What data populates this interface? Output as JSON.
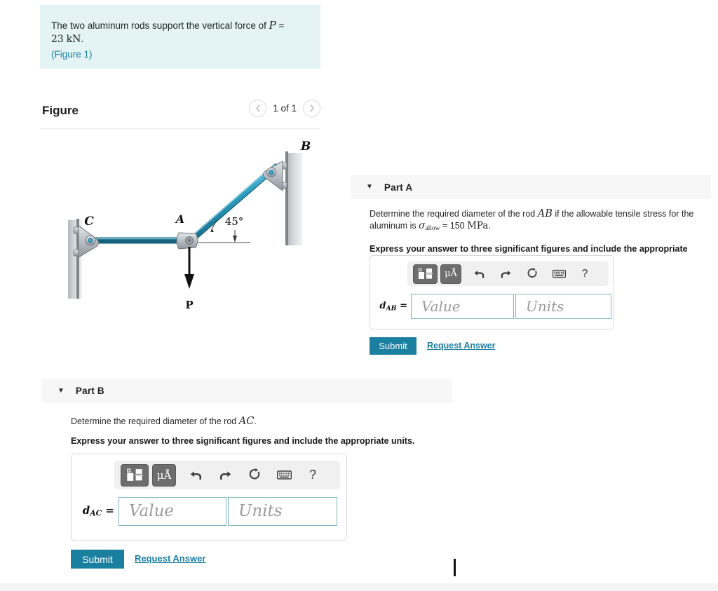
{
  "problem": {
    "text_1": "The two aluminum rods support the vertical force of ",
    "var_P": "P",
    "equals": " = ",
    "value": "23",
    "unit": "kN",
    "period": ".",
    "figure_link": "(Figure 1)"
  },
  "figure": {
    "title": "Figure",
    "prev_icon": "chevron-left-icon",
    "next_icon": "chevron-right-icon",
    "pager_label": "1 of 1",
    "labels": {
      "point_a": "A",
      "point_b": "B",
      "point_c": "C",
      "force": "P",
      "angle": "45°"
    },
    "colors": {
      "rod": "#2e9fc0",
      "rod_dark": "#1b6f8c",
      "bracket": "#b9bfc4",
      "wall": "#8a8f93"
    }
  },
  "part_a": {
    "caret_icon": "caret-down-icon",
    "title": "Part A",
    "question_pre": "Determine the required diameter of the rod ",
    "question_var": "AB",
    "question_mid": " if the allowable tensile stress for the aluminum is ",
    "sigma": "σ",
    "sigma_sub": "allow",
    "sigma_eq": " = 150 ",
    "sigma_unit": "MPa",
    "question_end": ".",
    "instruction": "Express your answer to three significant figures and include the appropriate units.",
    "toolbar": {
      "template_icon": "math-template-icon",
      "units_icon": "micro-angstrom-units-icon",
      "undo_icon": "undo-icon",
      "redo_icon": "redo-icon",
      "reset_icon": "reset-icon",
      "keyboard_icon": "keyboard-icon",
      "help_icon": "help-icon",
      "help_label": "?",
      "units_label": "μÅ"
    },
    "answer_label": "d",
    "answer_label_sub": "AB",
    "answer_label_eq": " =",
    "value_placeholder": "Value",
    "units_placeholder": "Units",
    "submit_label": "Submit",
    "request_answer_label": "Request Answer"
  },
  "part_b": {
    "caret_icon": "caret-down-icon",
    "title": "Part B",
    "question_pre": "Determine the required diameter of the rod ",
    "question_var": "AC",
    "question_end": ".",
    "instruction": "Express your answer to three significant figures and include the appropriate units.",
    "toolbar": {
      "template_icon": "math-template-icon",
      "units_icon": "micro-angstrom-units-icon",
      "undo_icon": "undo-icon",
      "redo_icon": "redo-icon",
      "reset_icon": "reset-icon",
      "keyboard_icon": "keyboard-icon",
      "help_icon": "help-icon",
      "help_label": "?",
      "units_label": "μÅ"
    },
    "answer_label": "d",
    "answer_label_sub": "AC",
    "answer_label_eq": " =",
    "value_placeholder": "Value",
    "units_placeholder": "Units",
    "submit_label": "Submit",
    "request_answer_label": "Request Answer"
  },
  "theme": {
    "accent": "#1b7fa0",
    "problem_bg": "#e4f3f3",
    "part_header_bg": "#f7f7f7",
    "input_border": "#7fb5c4"
  }
}
